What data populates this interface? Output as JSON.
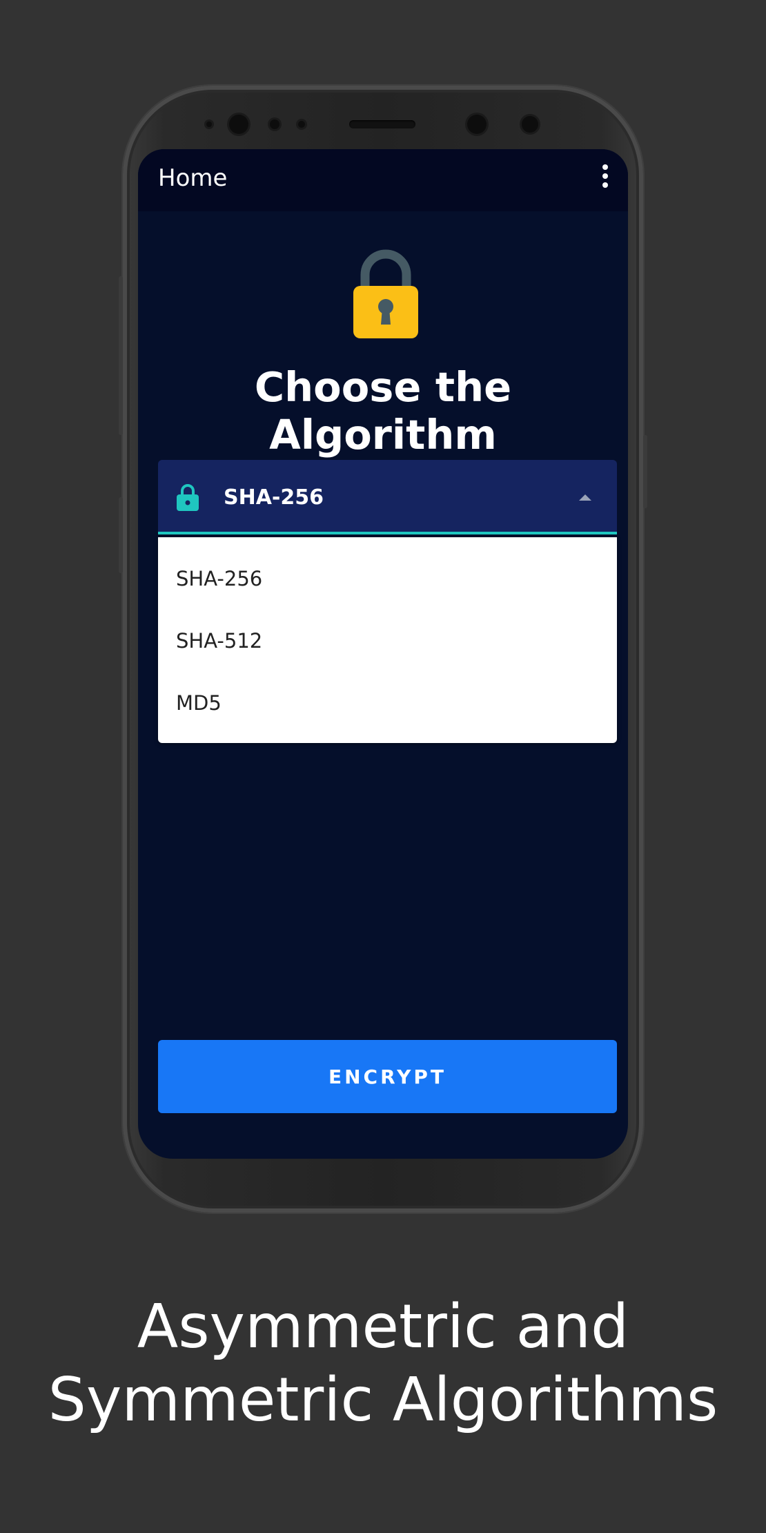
{
  "appbar": {
    "title": "Home",
    "menu_icon": "more-vert-icon"
  },
  "hero": {
    "icon": "padlock-icon",
    "headline": "Choose the Algorithm"
  },
  "algorithm_select": {
    "icon": "lock-icon",
    "selected": "SHA-256",
    "expanded": true,
    "options": [
      "SHA-256",
      "SHA-512",
      "MD5"
    ]
  },
  "actions": {
    "encrypt_label": "ENCRYPT"
  },
  "caption": {
    "line1": "Asymmetric and",
    "line2": "Symmetric Algorithms"
  },
  "colors": {
    "background": "#333333",
    "screen_bg": "#050f2b",
    "appbar_bg": "#030822",
    "field_bg": "#152460",
    "accent_teal": "#1fc6c0",
    "primary_button": "#1877f6",
    "lock_body": "#fbbf16",
    "lock_shackle": "#455a64"
  }
}
